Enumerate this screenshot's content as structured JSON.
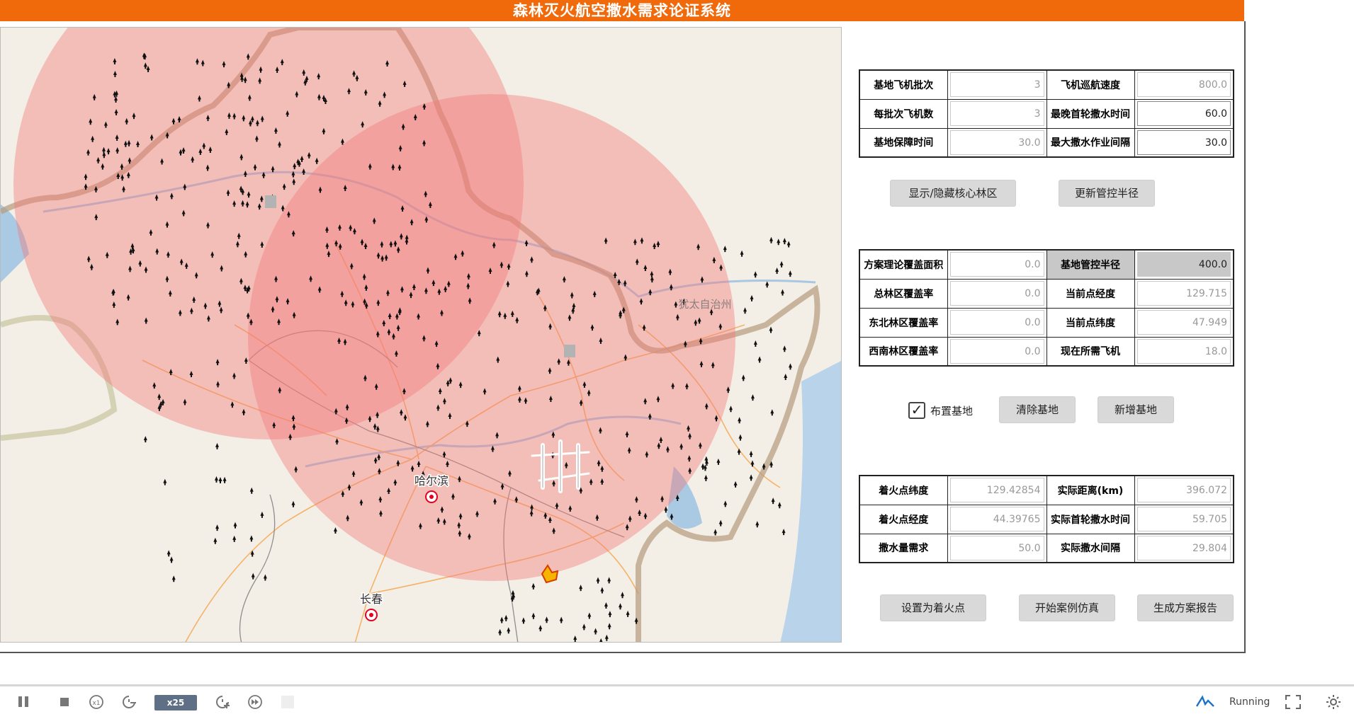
{
  "app": {
    "title": "森林灭火航空撒水需求论证系统"
  },
  "map": {
    "labels": {
      "city1": "哈尔滨",
      "city2": "长春",
      "region": "犹太自治州"
    }
  },
  "params": {
    "rows": [
      {
        "label_l": "基地飞机批次",
        "value_l": "3",
        "label_r": "飞机巡航速度",
        "value_r": "800.0"
      },
      {
        "label_l": "每批次飞机数",
        "value_l": "3",
        "label_r": "最晚首轮撒水时间",
        "value_r": "60.0"
      },
      {
        "label_l": "基地保障时间",
        "value_l": "30.0",
        "label_r": "最大撒水作业间隔",
        "value_r": "30.0"
      }
    ]
  },
  "buttons": {
    "toggle_core": "显示/隐藏核心林区",
    "update_radius": "更新管控半径",
    "clear_base": "清除基地",
    "add_base": "新增基地",
    "set_fire": "设置为着火点",
    "start_sim": "开始案例仿真",
    "report": "生成方案报告"
  },
  "coverage": {
    "rows": [
      {
        "label_l": "方案理论覆盖面积",
        "value_l": "0.0",
        "label_r": "基地管控半径",
        "value_r": "400.0"
      },
      {
        "label_l": "总林区覆盖率",
        "value_l": "0.0",
        "label_r": "当前点经度",
        "value_r": "129.715"
      },
      {
        "label_l": "东北林区覆盖率",
        "value_l": "0.0",
        "label_r": "当前点纬度",
        "value_r": "47.949"
      },
      {
        "label_l": "西南林区覆盖率",
        "value_l": "0.0",
        "label_r": "现在所需飞机",
        "value_r": "18.0"
      }
    ]
  },
  "base_option": {
    "label": "布置基地",
    "checked": true
  },
  "fire": {
    "rows": [
      {
        "label_l": "着火点纬度",
        "value_l": "129.42854",
        "label_r": "实际距离(km)",
        "value_r": "396.072"
      },
      {
        "label_l": "着火点经度",
        "value_l": "44.39765",
        "label_r": "实际首轮撒水时间",
        "value_r": "59.705"
      },
      {
        "label_l": "撒水量需求",
        "value_l": "50.0",
        "label_r": "实际撒水间隔",
        "value_r": "29.804"
      }
    ]
  },
  "toolbar": {
    "speed": "x25",
    "x1": "x1",
    "status": "Running"
  },
  "colors": {
    "title_bar": "#f06a0b",
    "circle": "#f47a7a",
    "button": "#d9d9d9"
  },
  "icons": [
    "pause-icon",
    "stop-icon",
    "speed-x1-icon",
    "slow-down-icon",
    "speed-up-icon",
    "fast-forward-icon",
    "status-graph-icon",
    "fullscreen-icon",
    "settings-icon"
  ]
}
